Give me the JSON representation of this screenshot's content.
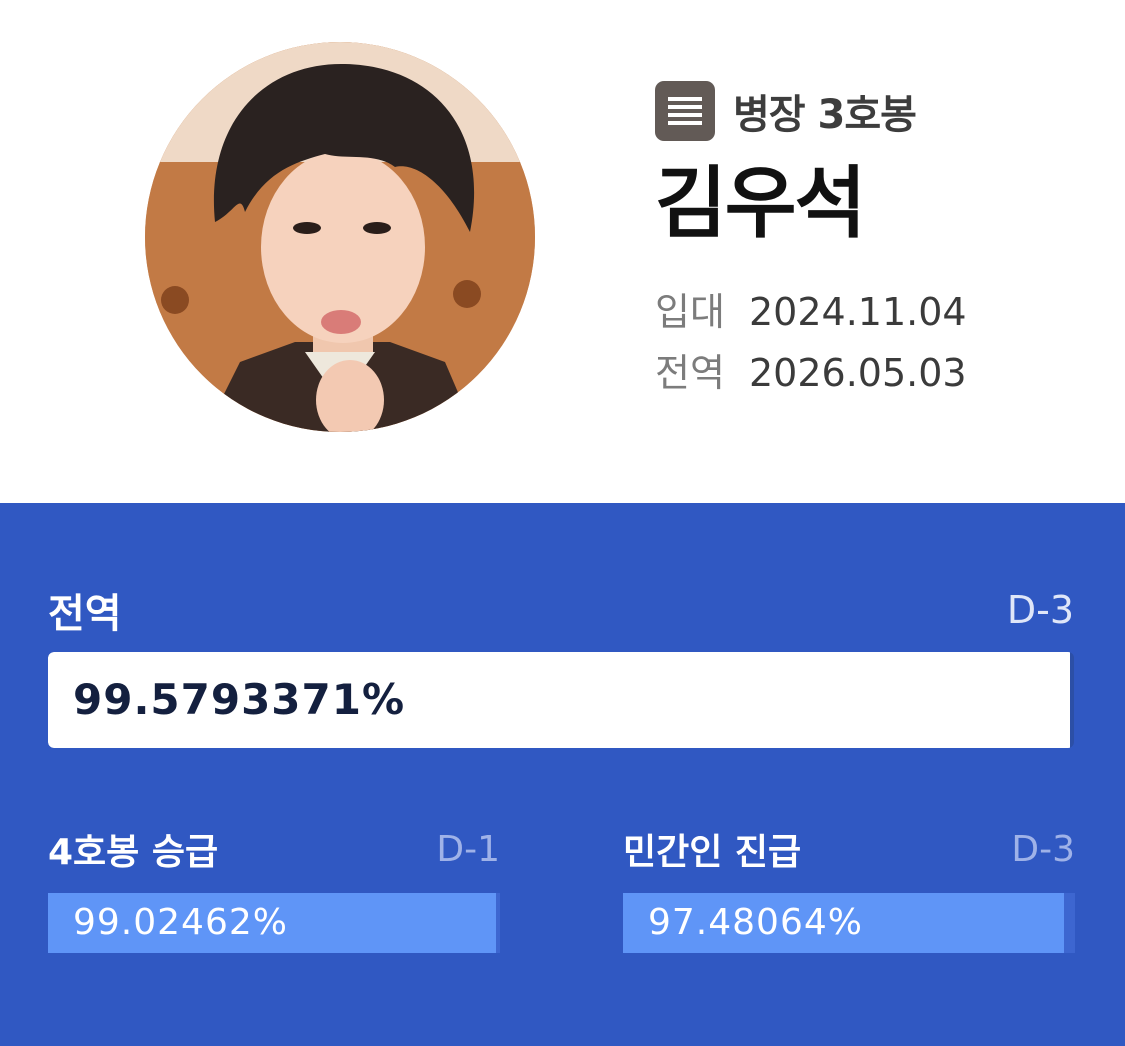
{
  "profile": {
    "rank": "병장 3호봉",
    "rank_icon": "rank-badge-icon",
    "name": "김우석",
    "enlist_label": "입대",
    "enlist_date": "2024.11.04",
    "discharge_label": "전역",
    "discharge_date": "2026.05.03"
  },
  "progress": {
    "main": {
      "title": "전역",
      "dday": "D-3",
      "percent_text": "99.5793371%",
      "percent": 99.5793371
    },
    "promotion": {
      "title": "4호봉 승급",
      "dday": "D-1",
      "percent_text": "99.02462%",
      "percent": 99.02462
    },
    "civilian": {
      "title": "민간인 진급",
      "dday": "D-3",
      "percent_text": "97.48064%",
      "percent": 97.48064
    }
  },
  "colors": {
    "panel_bg": "#3058c2",
    "bar_fill": "#5f95f7",
    "rank_badge": "#625a56"
  }
}
